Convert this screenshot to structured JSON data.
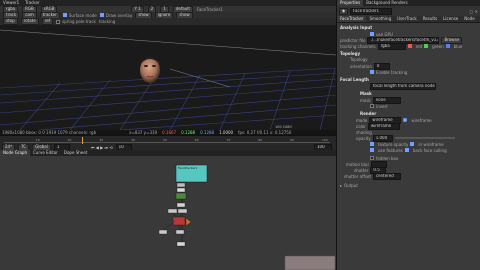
{
  "viewer": {
    "tabs": [
      "Viewer1",
      "Tracker"
    ],
    "top_row": [
      "rgba",
      "RGB",
      "sRGB"
    ],
    "second_row": [
      "Y 1",
      "2",
      "1",
      "default",
      "FaceTracker1"
    ],
    "toolbar": [
      "track",
      "cam",
      "tracker",
      "Surface mode",
      "Draw overlay",
      "show",
      "ignore",
      "show"
    ],
    "toolbar2": [
      "stop",
      "rotate",
      "ref",
      "spring pole track",
      "tracking"
    ],
    "status": "1980x1080  bbox: 0 0 1919 1079 channels: rgb",
    "coords": "x=837 y=319",
    "pixel_values": [
      "0.1667",
      "0.1288",
      "0.1288",
      "1.0000"
    ],
    "right_info": "fps: 0.27 f/0.11  x: 0.12750",
    "frame_label": "100 1080"
  },
  "timeline": {
    "controls": [
      "24*",
      "TC",
      "Global",
      "10"
    ],
    "start": "1",
    "end": "100",
    "markers": [
      "10",
      "20",
      "30",
      "40",
      "50",
      "60",
      "70",
      "80",
      "90",
      "100"
    ]
  },
  "nodegraph": {
    "tabs": [
      "Node Graph",
      "Curve Editor",
      "Dope Sheet"
    ],
    "node_label": "FaceTracker1"
  },
  "properties": {
    "title": "Properties",
    "panel_title": "Background Renders",
    "node_name": "FaceTracker1",
    "tabs": [
      "FaceTracker",
      "Smoothing",
      "UserTrack",
      "Results",
      "License",
      "Node"
    ],
    "analysis_input_label": "Analysis Input",
    "use_gpu": "use GPU",
    "predictor_file_label": "predictor file",
    "predictor_file": "./.../nuke/facetrackers/facetrk_v13_...predicts",
    "browse": "Browse",
    "tracking_channels_label": "tracking channels",
    "tracking_channel": "rgba",
    "channels": [
      "red",
      "green",
      "blue"
    ],
    "topology": "Topology",
    "topology_label": "Topology",
    "orientation_label": "orientation",
    "orientation_value": "0",
    "orientation_flag": "Enable tracking",
    "focal_length": "Focal Length",
    "focal_mode": "focal length from camera node",
    "mask_section": "Mask",
    "mask_label": "mask",
    "mask_value": "none",
    "invert": "invert",
    "render_section": "Render",
    "mode_label": "mode",
    "mode_value": "wireframe",
    "wire_mode": "wireframe",
    "color_label": "color",
    "color_value": "wireframe",
    "shading_label": "shading",
    "opacity_label": "opacity",
    "opacity_value": "1.000",
    "opt1": "texture opacity",
    "opt1b": "in wireframe",
    "opt2": "use features",
    "opt2b": "back face culling",
    "hidden_box": "hidden box",
    "motion_blur_label": "motion blur",
    "shutter_label": "shutter",
    "shutter_value": "0.5",
    "shutter_offset_label": "shutter offset",
    "shutter_offset_value": "centered",
    "output_label": "Output"
  }
}
